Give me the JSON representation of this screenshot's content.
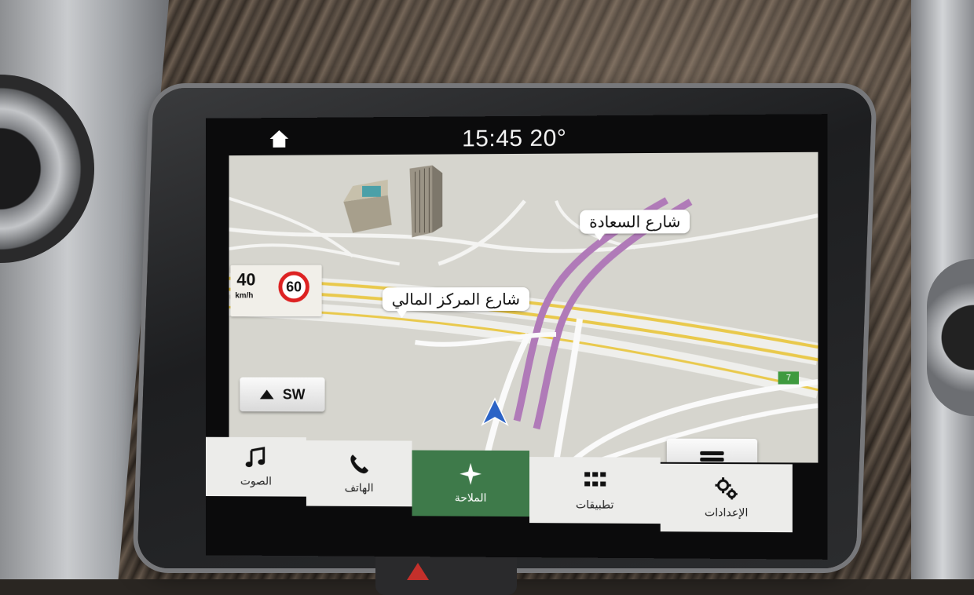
{
  "status": {
    "time_temp": "15:45 20°"
  },
  "speed": {
    "current": "40",
    "unit": "km/h",
    "limit": "60"
  },
  "compass": {
    "heading": "SW"
  },
  "streets": {
    "street_1": "شارع السعادة",
    "street_2": "شارع المركز المالي"
  },
  "route_badge": "7",
  "nav": {
    "audio": "الصوت",
    "phone": "الهاتف",
    "navigation": "الملاحة",
    "apps": "تطبيقات",
    "settings": "الإعدادات"
  },
  "colors": {
    "active_tab": "#3e7a4a",
    "speed_limit_ring": "#dd2222",
    "route_purple": "#b07ab8",
    "road_yellow": "#e9c94c"
  },
  "icons": [
    "home-icon",
    "music-note-icon",
    "phone-icon",
    "navigation-star-icon",
    "apps-grid-icon",
    "gears-icon",
    "menu-icon",
    "arrow-up-icon",
    "position-arrow-icon"
  ]
}
